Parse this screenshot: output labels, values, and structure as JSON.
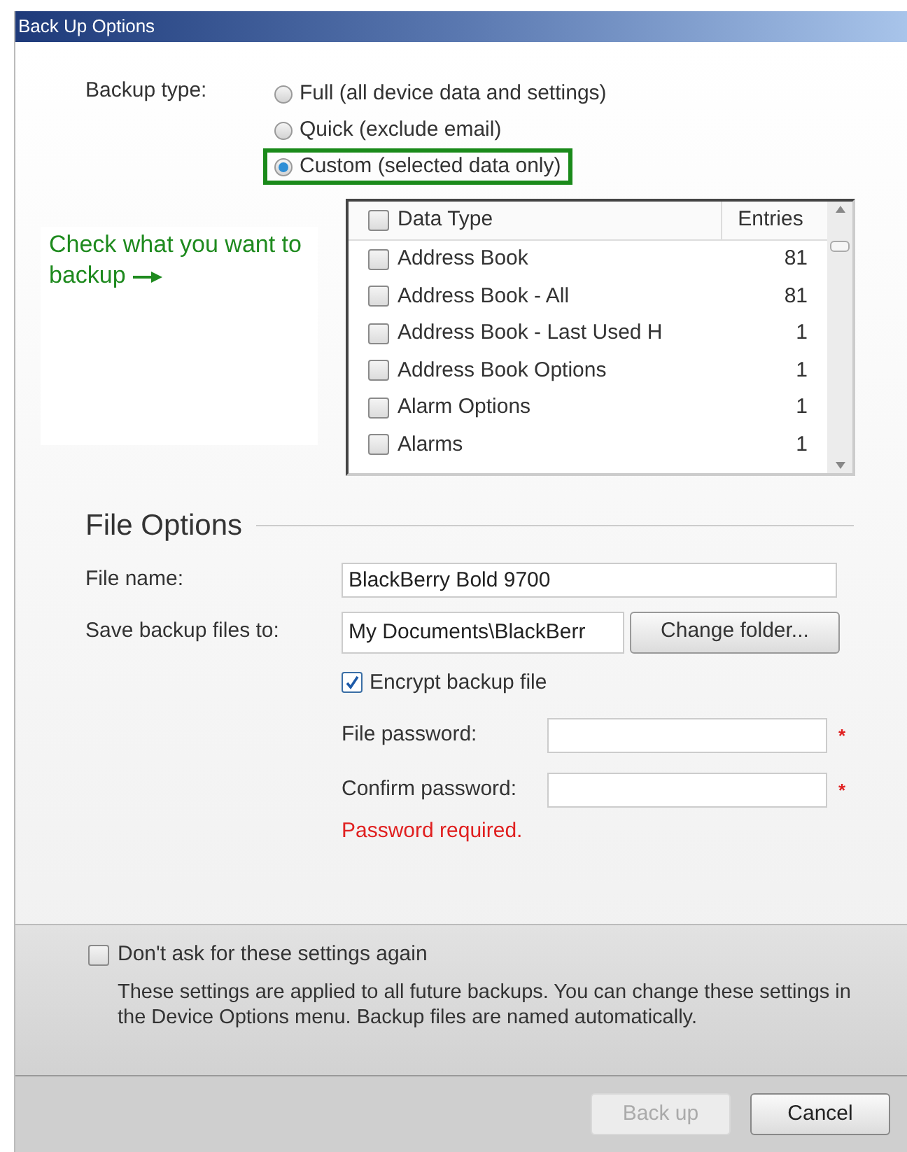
{
  "window": {
    "title": "Back Up Options"
  },
  "backup_type": {
    "label": "Backup type:",
    "options": [
      {
        "label": "Full (all device data and settings)",
        "selected": false,
        "highlighted": false
      },
      {
        "label": "Quick (exclude email)",
        "selected": false,
        "highlighted": false
      },
      {
        "label": "Custom (selected data only)",
        "selected": true,
        "highlighted": true
      }
    ]
  },
  "callout": {
    "text": "Check what you want to backup"
  },
  "data_table": {
    "columns": [
      "Data Type",
      "Entries"
    ],
    "select_all_checked": false,
    "rows": [
      {
        "name": "Address Book",
        "entries": "81",
        "checked": false
      },
      {
        "name": "Address Book - All",
        "entries": "81",
        "checked": false
      },
      {
        "name": "Address Book - Last Used H",
        "entries": "1",
        "checked": false
      },
      {
        "name": "Address Book Options",
        "entries": "1",
        "checked": false
      },
      {
        "name": "Alarm Options",
        "entries": "1",
        "checked": false
      },
      {
        "name": "Alarms",
        "entries": "1",
        "checked": false
      }
    ]
  },
  "file_options": {
    "heading": "File Options",
    "file_name": {
      "label": "File name:",
      "value": "BlackBerry Bold 9700"
    },
    "save_to": {
      "label": "Save backup files to:",
      "value": "My Documents\\BlackBerr",
      "button": "Change folder..."
    },
    "encrypt": {
      "label": "Encrypt backup file",
      "checked": true
    },
    "file_password": {
      "label": "File password:",
      "required_mark": "*"
    },
    "confirm_password": {
      "label": "Confirm password:",
      "required_mark": "*"
    },
    "error": "Password required."
  },
  "dont_ask": {
    "label": "Don't ask for these settings again",
    "checked": false
  },
  "note": "These settings are applied to all future backups. You can change these settings in the Device Options menu. Backup files are named automatically.",
  "buttons": [
    {
      "label": "Back up",
      "disabled": true
    },
    {
      "label": "Cancel",
      "disabled": false
    }
  ]
}
